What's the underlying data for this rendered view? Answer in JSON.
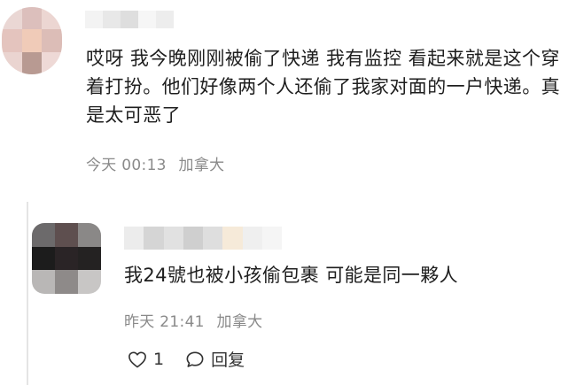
{
  "comment": {
    "avatar_mosaic": [
      "#ead7d4",
      "#dcbfbc",
      "#ecd6d2",
      "#e4c4be",
      "#f0cbb8",
      "#dcbdb7",
      "#ead4d0",
      "#b89a92",
      "#eed9d6"
    ],
    "username_mosaic": [
      "#f3f3f3",
      "#e8e8e8",
      "#dedede",
      "#f6f6f6",
      "#ededed"
    ],
    "text": "哎呀 我今晚刚刚被偷了快递 我有监控 看起来就是这个穿着打扮。他们好像两个人还偷了我家对面的一户快递。真是太可恶了",
    "time": "今天 00:13",
    "location": "加拿大"
  },
  "reply": {
    "avatar_mosaic": [
      "#6c6a6b",
      "#5e4f4f",
      "#8a8887",
      "#1c1c1c",
      "#2a2426",
      "#242222",
      "#b9b7b6",
      "#8e8a89",
      "#c8c6c5"
    ],
    "username_mosaic": [
      "#ececec",
      "#d5d5d5",
      "#e1e1e1",
      "#cfcfcf",
      "#dedede",
      "#f6ead9",
      "#efefef",
      "#f5f5f5"
    ],
    "text": "我24號也被小孩偷包裹 可能是同一夥人",
    "time": "昨天 21:41",
    "location": "加拿大",
    "actions": {
      "like_icon": "heart-outline-icon",
      "like_count": "1",
      "reply_icon": "speech-bubble-icon",
      "reply_label": "回复"
    }
  }
}
